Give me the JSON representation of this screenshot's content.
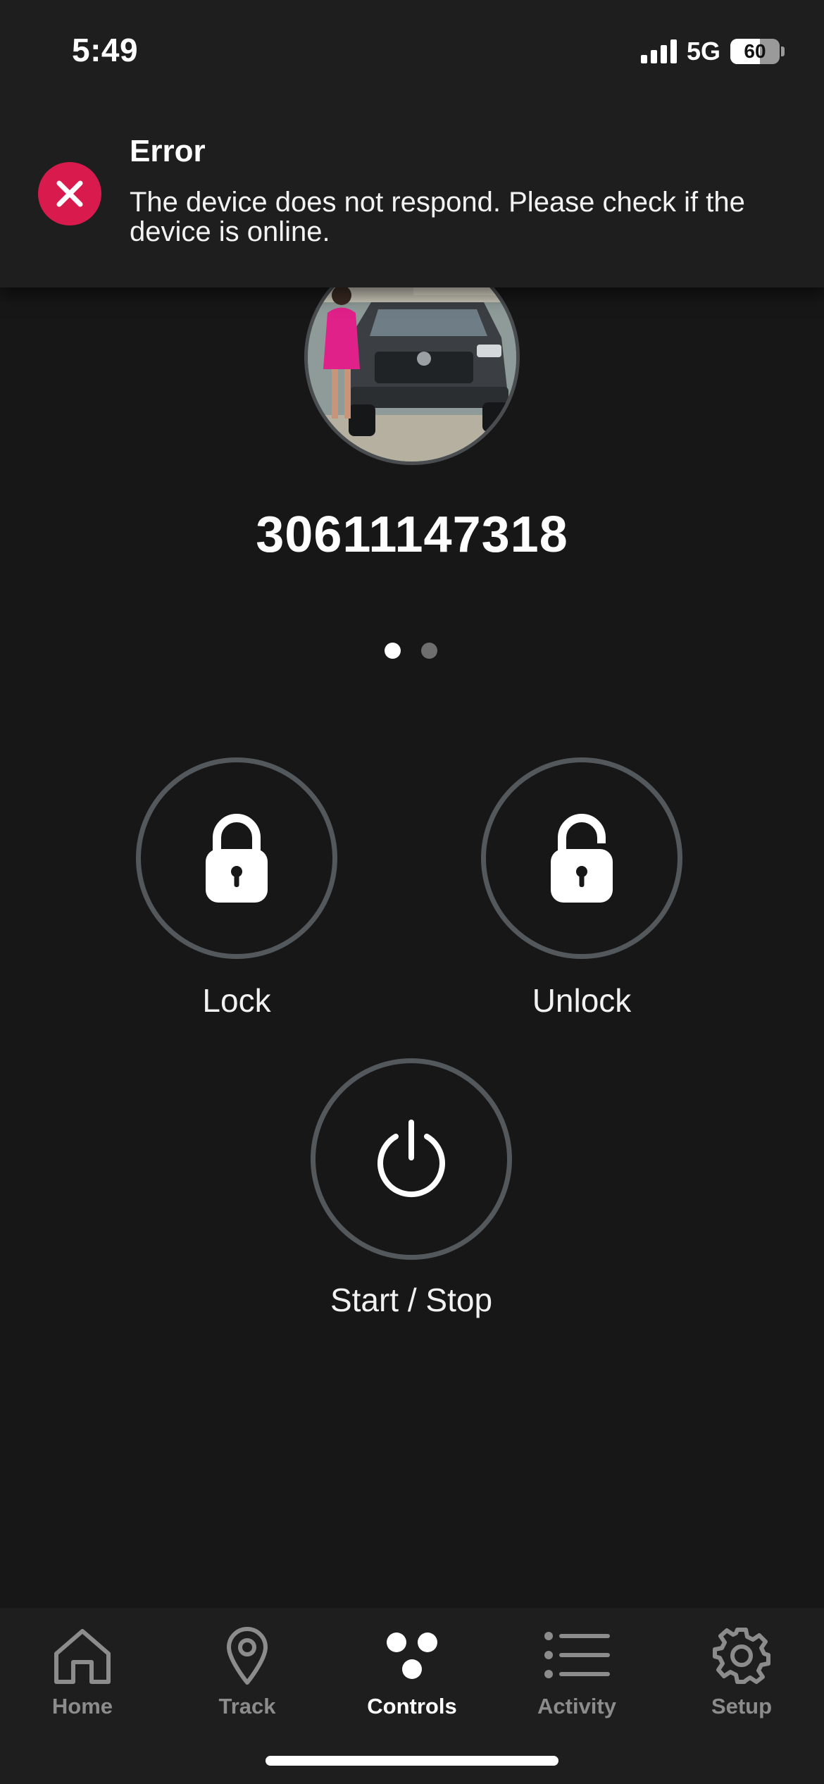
{
  "status_bar": {
    "time": "5:49",
    "network": "5G",
    "battery": "60"
  },
  "toast": {
    "title": "Error",
    "message": "The device does not respond. Please check if the device is online.",
    "icon": "close-icon",
    "accent_color": "#d81b4c"
  },
  "vehicle": {
    "id": "30611147318",
    "page_count": 2,
    "active_page": 1
  },
  "controls": {
    "lock_label": "Lock",
    "unlock_label": "Unlock",
    "start_stop_label": "Start / Stop"
  },
  "bottom_nav": {
    "items": [
      {
        "label": "Home",
        "icon": "home-icon"
      },
      {
        "label": "Track",
        "icon": "location-pin-icon"
      },
      {
        "label": "Controls",
        "icon": "controls-icon",
        "active": true
      },
      {
        "label": "Activity",
        "icon": "list-icon"
      },
      {
        "label": "Setup",
        "icon": "gear-icon"
      }
    ]
  }
}
